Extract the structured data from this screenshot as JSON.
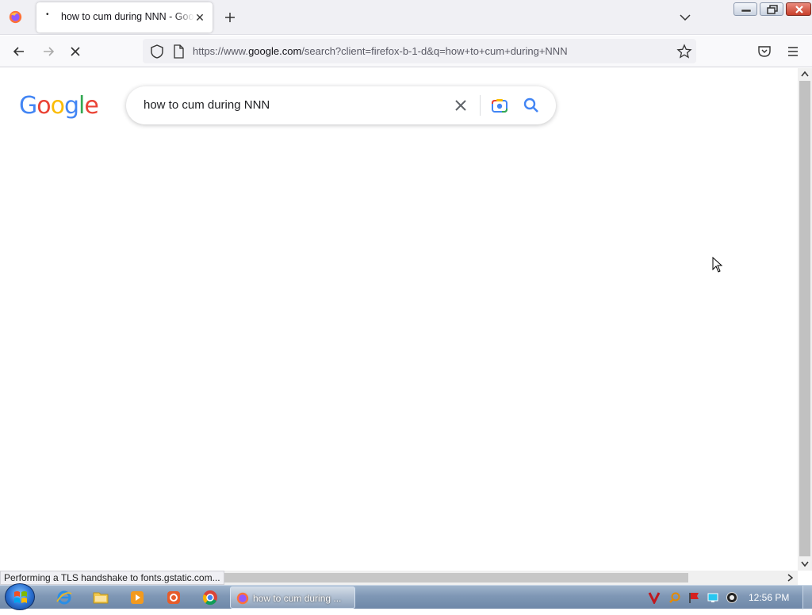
{
  "browser": {
    "tab": {
      "title": "how to cum during NNN - Google Search"
    },
    "url": {
      "prefix": "https://www.",
      "domain": "google.com",
      "path": "/search?client=firefox-b-1-d&q=how+to+cum+during+NNN"
    }
  },
  "google": {
    "logo": [
      "G",
      "o",
      "o",
      "g",
      "l",
      "e"
    ],
    "logo_colors": [
      "#4285f4",
      "#ea4335",
      "#fbbc05",
      "#4285f4",
      "#34a853",
      "#ea4335"
    ],
    "search_query": "how to cum during NNN"
  },
  "status_bar": {
    "text": "Performing a TLS handshake to fonts.gstatic.com..."
  },
  "taskbar": {
    "active_task": "how to cum during ...",
    "clock": "12:56 PM"
  },
  "icons": [
    "firefox-icon",
    "new-tab-icon",
    "tab-list-chevron-icon",
    "back-arrow-icon",
    "forward-arrow-icon",
    "stop-loading-icon",
    "shield-icon",
    "page-info-icon",
    "bookmark-star-icon",
    "pocket-icon",
    "hamburger-menu-icon",
    "close-icon",
    "google-lens-icon",
    "search-icon",
    "windows-start-icon",
    "internet-explorer-icon",
    "file-explorer-icon",
    "media-player-icon",
    "app-icon",
    "chrome-icon"
  ]
}
